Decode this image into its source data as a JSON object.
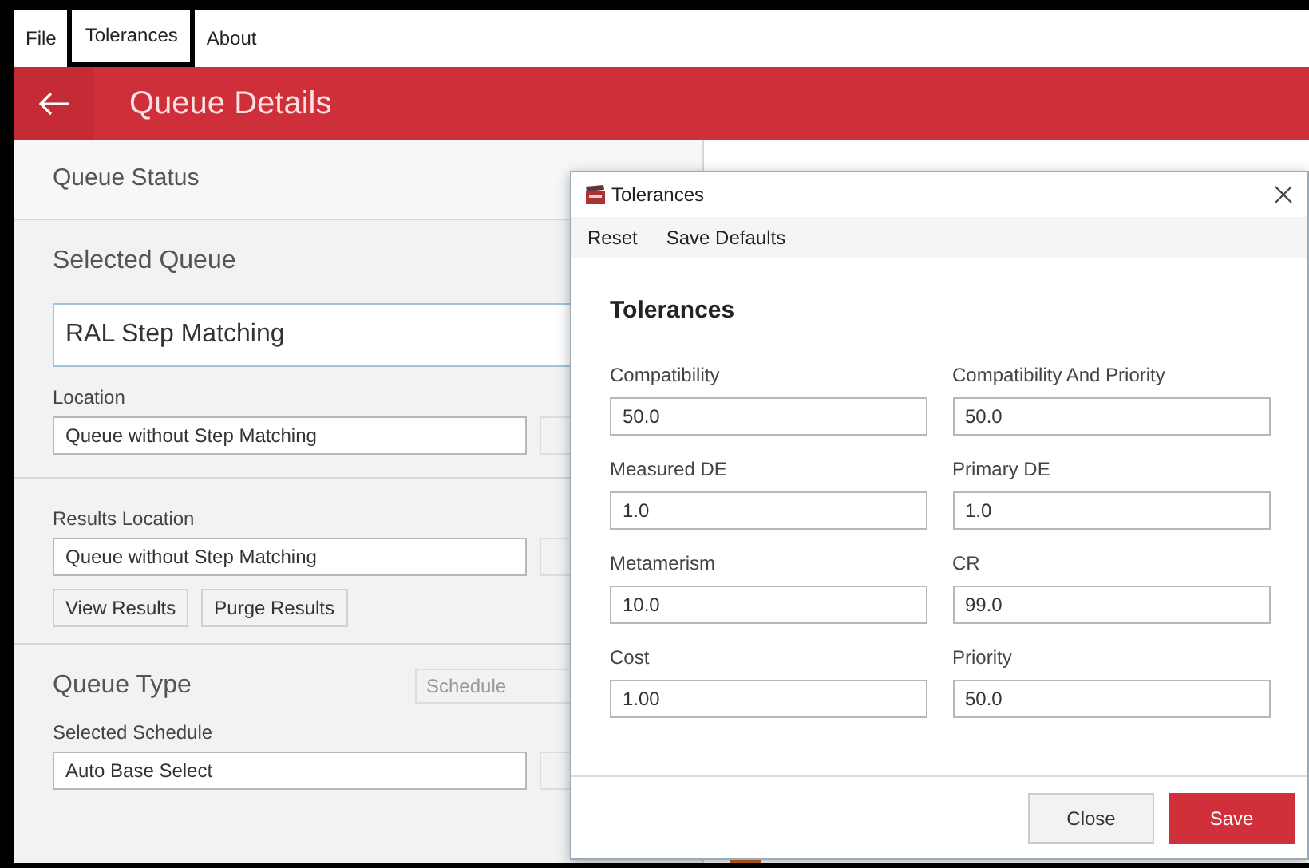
{
  "menu": [
    {
      "label": "File",
      "selected": false
    },
    {
      "label": "Tolerances",
      "selected": true
    },
    {
      "label": "About",
      "selected": false
    }
  ],
  "header": {
    "title": "Queue Details"
  },
  "panel": {
    "status_title": "Queue Status",
    "selected_queue_title": "Selected Queue",
    "selected_queue_value": "RAL Step Matching",
    "location_label": "Location",
    "location_value": "Queue without Step Matching",
    "results_location_label": "Results Location",
    "results_location_value": "Queue without Step Matching",
    "buttons": [
      "View Results",
      "Purge Results"
    ],
    "queue_type_title": "Queue Type",
    "queue_type_value": "Schedule",
    "selected_schedule_label": "Selected Schedule",
    "selected_schedule_value": "Auto Base Select"
  },
  "dialog": {
    "title": "Tolerances",
    "menu": [
      "Reset",
      "Save Defaults"
    ],
    "heading": "Tolerances",
    "fields": [
      {
        "label": "Compatibility",
        "value": "50.0"
      },
      {
        "label": "Compatibility And Priority",
        "value": "50.0"
      },
      {
        "label": "Measured DE",
        "value": "1.0"
      },
      {
        "label": "Primary DE",
        "value": "1.0"
      },
      {
        "label": "Metamerism",
        "value": "10.0"
      },
      {
        "label": "CR",
        "value": "99.0"
      },
      {
        "label": "Cost",
        "value": "1.00"
      },
      {
        "label": "Priority",
        "value": "50.0"
      }
    ],
    "buttons": [
      {
        "label": "Close",
        "kind": "secondary"
      },
      {
        "label": "Save",
        "kind": "primary"
      }
    ]
  }
}
